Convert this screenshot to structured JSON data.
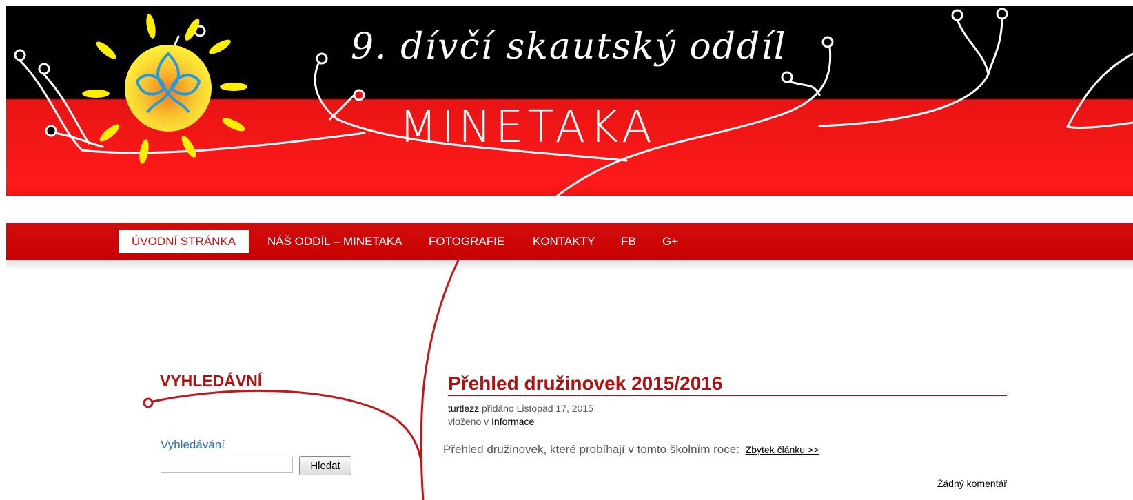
{
  "header": {
    "title": "9. dívčí skautský oddíl",
    "subtitle": "MINETAKA"
  },
  "nav": {
    "items": [
      {
        "label": "ÚVODNÍ STRÁNKA",
        "active": true
      },
      {
        "label": "NÁŠ ODDÍL – MINETAKA"
      },
      {
        "label": "FOTOGRAFIE"
      },
      {
        "label": "KONTAKTY"
      },
      {
        "label": "FB"
      },
      {
        "label": "G+"
      }
    ]
  },
  "sidebar": {
    "widget_title": "VYHLEDÁVNÍ",
    "search_label": "Vyhledávání",
    "search_value": "",
    "search_button": "Hledat"
  },
  "post": {
    "title": "Přehled družinovek 2015/2016",
    "author": "turtlezz",
    "added_text": " přidáno Listopad 17, 2015",
    "category_prefix": "vloženo v ",
    "category": "Informace",
    "excerpt": "Přehled družinovek, které probíhají v tomto školním roce:",
    "read_more": "Zbytek článku >>",
    "comments": "Žádný komentář"
  },
  "colors": {
    "brand_red": "#c80f0f",
    "header_black": "#000000",
    "title_red": "#b01010",
    "label_blue": "#2a6fb5"
  }
}
